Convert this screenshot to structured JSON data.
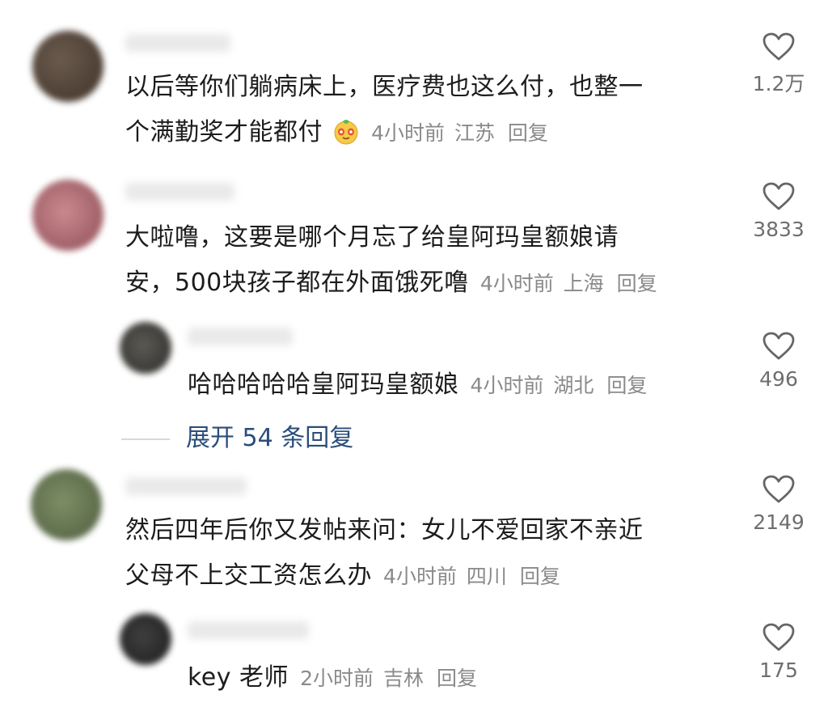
{
  "comments": [
    {
      "text_line1": "以后等你们躺病床上，医疗费也这么付，也整一",
      "text_line2": "个满勤奖才能都付",
      "emoji": "pudding-face-emoji",
      "time": "4小时前",
      "location": "江苏",
      "reply": "回复",
      "likes": "1.2万"
    },
    {
      "text_line1": "大啦噜，这要是哪个月忘了给皇阿玛皇额娘请",
      "text_line2": "安，500块孩子都在外面饿死噜",
      "time": "4小时前",
      "location": "上海",
      "reply": "回复",
      "likes": "3833",
      "replies": [
        {
          "text": "哈哈哈哈哈皇阿玛皇额娘",
          "time": "4小时前",
          "location": "湖北",
          "reply": "回复",
          "likes": "496"
        }
      ],
      "expand_label": "展开 54 条回复"
    },
    {
      "text_line1": "然后四年后你又发帖来问：女儿不爱回家不亲近",
      "text_line2": "父母不上交工资怎么办",
      "time": "4小时前",
      "location": "四川",
      "reply": "回复",
      "likes": "2149",
      "replies": [
        {
          "text": "key 老师",
          "time": "2小时前",
          "location": "吉林",
          "reply": "回复",
          "likes": "175"
        }
      ]
    }
  ],
  "icons": {
    "like": "heart-outline-icon"
  },
  "colors": {
    "text": "#1c1c1c",
    "meta": "#8a8a8a",
    "link": "#2a4d7a",
    "icon": "#666666"
  }
}
